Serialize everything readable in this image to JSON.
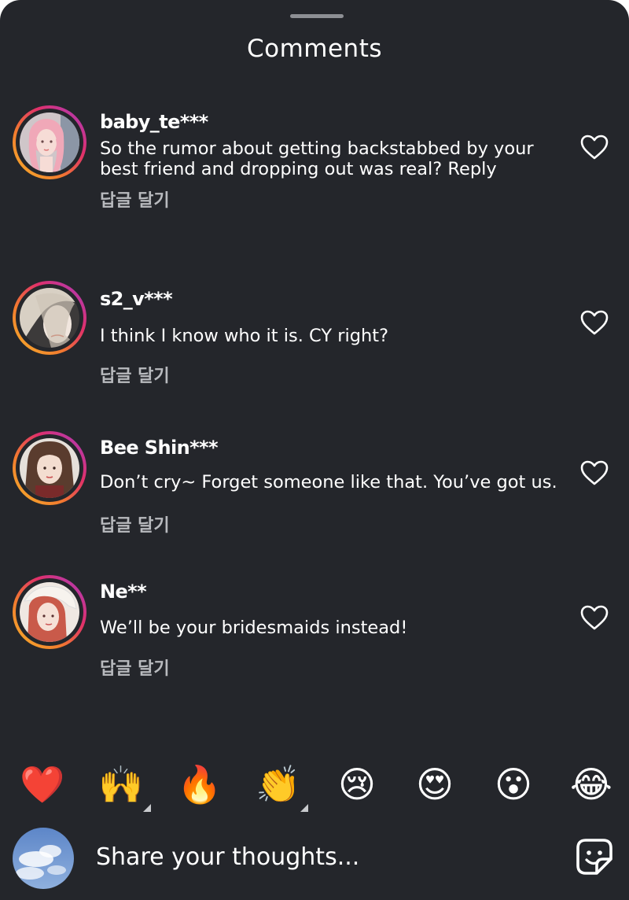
{
  "header": {
    "title": "Comments"
  },
  "comments": [
    {
      "username": "baby_te***",
      "text": "So the rumor about getting backstabbed by your best friend and dropping out was real? Reply",
      "reply_label": "답글 달기",
      "avatar_icon": "avatar-pink-hair",
      "liked": false
    },
    {
      "username": "s2_v***",
      "text": "I think I know who it is. CY right?",
      "reply_label": "답글 달기",
      "avatar_icon": "avatar-light-hair",
      "liked": false
    },
    {
      "username": "Bee Shin***",
      "text": "Don’t cry~ Forget someone like that. You’ve got us.",
      "reply_label": "답글 달기",
      "avatar_icon": "avatar-brown-hair",
      "liked": false
    },
    {
      "username": "Ne**",
      "text": "We’ll be your bridesmaids instead!",
      "reply_label": "답글 달기",
      "avatar_icon": "avatar-red-hair-veil",
      "liked": false
    }
  ],
  "reactions": [
    {
      "name": "red-heart",
      "glyph": "❤️"
    },
    {
      "name": "raising-hands",
      "glyph": "🙌"
    },
    {
      "name": "fire",
      "glyph": "🔥"
    },
    {
      "name": "clapping-hands",
      "glyph": "👏"
    },
    {
      "name": "crying-face",
      "glyph": "😢"
    },
    {
      "name": "heart-eyes",
      "glyph": "😍"
    },
    {
      "name": "surprised-face",
      "glyph": "😮"
    },
    {
      "name": "tears-of-joy",
      "glyph": "😂"
    }
  ],
  "composer": {
    "placeholder": "Share your thoughts...",
    "avatar_icon": "sky-clouds-avatar",
    "sticker_icon": "sticker-icon"
  },
  "colors": {
    "background": "#24262b",
    "text": "#ffffff",
    "secondary_text": "#b8babe",
    "ring_gradient": [
      "#f5b52a",
      "#e0306a",
      "#a43cc6"
    ]
  }
}
